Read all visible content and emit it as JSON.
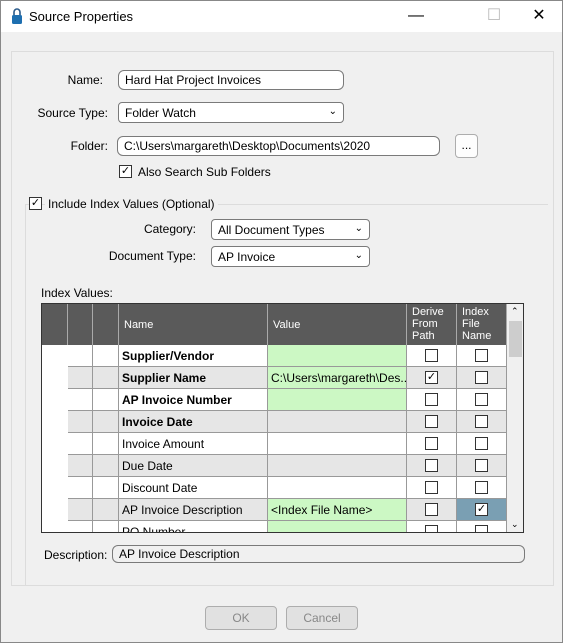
{
  "window": {
    "title": "Source Properties",
    "icon": "lock-icon"
  },
  "form": {
    "name_label": "Name:",
    "name_value": "Hard Hat Project Invoices",
    "source_type_label": "Source Type:",
    "source_type_value": "Folder Watch",
    "folder_label": "Folder:",
    "folder_value": "C:\\Users\\margareth\\Desktop\\Documents\\2020",
    "browse_label": "...",
    "subfolders_label": "Also Search Sub Folders",
    "subfolders_checked": true,
    "include_label": "Include Index Values (Optional)",
    "include_checked": true,
    "category_label": "Category:",
    "category_value": "All Document Types",
    "doctype_label": "Document Type:",
    "doctype_value": "AP Invoice",
    "index_values_label": "Index Values:",
    "description_label": "Description:",
    "description_value": "AP Invoice Description"
  },
  "grid": {
    "columns": [
      "Name",
      "Value",
      "Derive From Path",
      "Index File Name"
    ],
    "rows": [
      {
        "name": "Supplier/Vendor",
        "value": "",
        "required": true,
        "derive": false,
        "index": false,
        "green": true
      },
      {
        "name": "Supplier Name",
        "value": "C:\\Users\\margareth\\Des...",
        "required": true,
        "derive": true,
        "index": false,
        "green": true
      },
      {
        "name": "AP Invoice Number",
        "value": "",
        "required": true,
        "derive": false,
        "index": false,
        "green": true
      },
      {
        "name": "Invoice Date",
        "value": "",
        "required": true,
        "derive": false,
        "index": false,
        "green": false
      },
      {
        "name": "Invoice Amount",
        "value": "",
        "required": false,
        "derive": false,
        "index": false,
        "green": false
      },
      {
        "name": "Due Date",
        "value": "",
        "required": false,
        "derive": false,
        "index": false,
        "green": false
      },
      {
        "name": "Discount Date",
        "value": "",
        "required": false,
        "derive": false,
        "index": false,
        "green": false
      },
      {
        "name": "AP Invoice Description",
        "value": "<Index File Name>",
        "required": false,
        "derive": false,
        "index": true,
        "green": true,
        "selected": true
      },
      {
        "name": "PO Number",
        "value": "",
        "required": false,
        "derive": false,
        "index": false,
        "green": true
      }
    ]
  },
  "buttons": {
    "ok": "OK",
    "cancel": "Cancel"
  },
  "colors": {
    "required_value": "#ccf8c4",
    "selected_cell": "#7a9fb3",
    "header": "#5a5a5a"
  }
}
